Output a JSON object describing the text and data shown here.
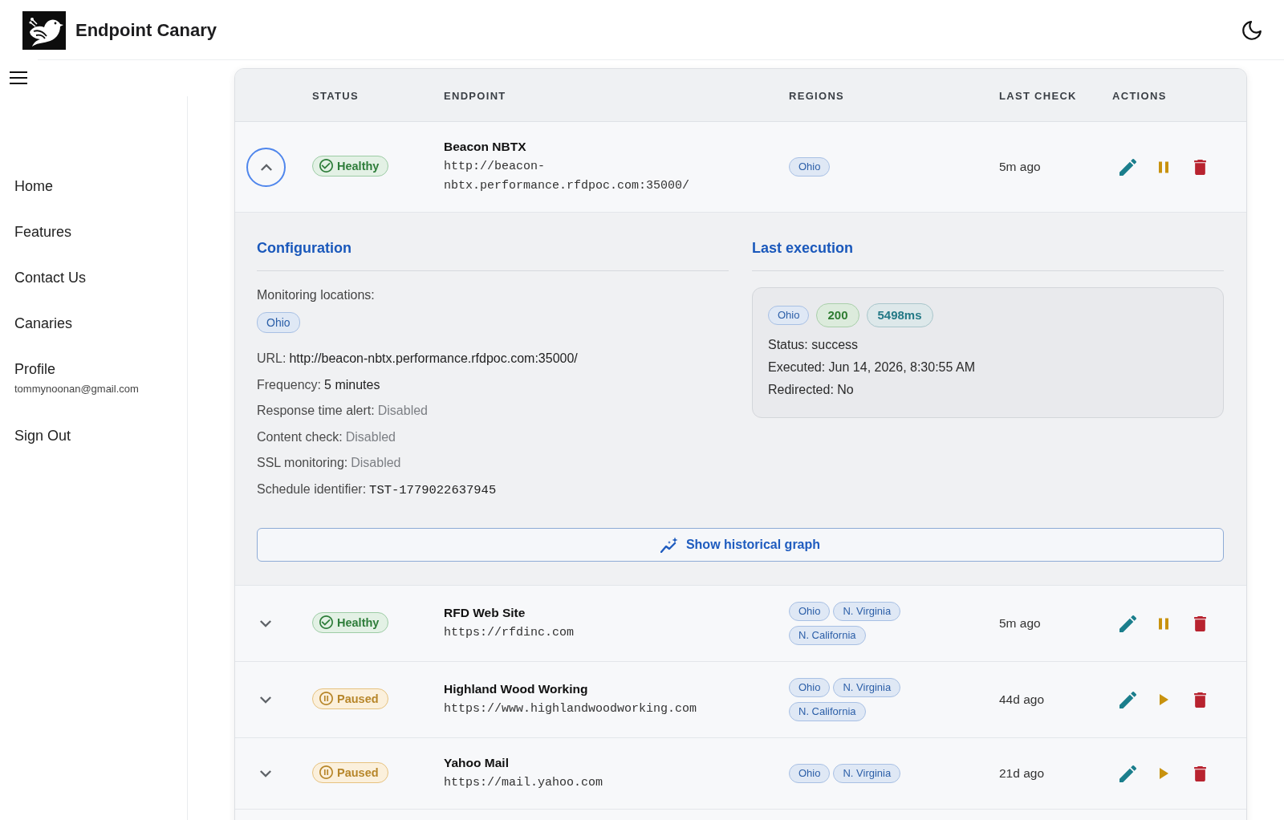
{
  "app": {
    "title": "Endpoint Canary"
  },
  "sidebar": {
    "items": [
      {
        "label": "Home"
      },
      {
        "label": "Features"
      },
      {
        "label": "Contact Us"
      },
      {
        "label": "Canaries"
      },
      {
        "label": "Profile",
        "detail": "tommynoonan@gmail.com"
      },
      {
        "label": "Sign Out"
      }
    ]
  },
  "table": {
    "columns": [
      "STATUS",
      "ENDPOINT",
      "REGIONS",
      "LAST CHECK",
      "ACTIONS"
    ],
    "rows": [
      {
        "expanded": true,
        "status": {
          "kind": "healthy",
          "label": "Healthy"
        },
        "name": "Beacon NBTX",
        "url": "http://beacon-nbtx.performance.rfdpoc.com:35000/",
        "regions": [
          "Ohio"
        ],
        "last_check": "5m ago",
        "details": {
          "configuration": {
            "title": "Configuration",
            "locations_label": "Monitoring locations:",
            "locations": [
              "Ohio"
            ],
            "fields": [
              {
                "label": "URL:",
                "value": "http://beacon-nbtx.performance.rfdpoc.com:35000/",
                "kind": "text"
              },
              {
                "label": "Frequency:",
                "value": "5 minutes",
                "kind": "text"
              },
              {
                "label": "Response time alert:",
                "value": "Disabled",
                "kind": "muted"
              },
              {
                "label": "Content check:",
                "value": "Disabled",
                "kind": "muted"
              },
              {
                "label": "SSL monitoring:",
                "value": "Disabled",
                "kind": "muted"
              },
              {
                "label": "Schedule identifier:",
                "value": "TST-1779022637945",
                "kind": "mono"
              }
            ]
          },
          "last_execution": {
            "title": "Last execution",
            "region": "Ohio",
            "status_code": "200",
            "duration": "5498ms",
            "lines": [
              "Status: success",
              "Executed: Jun 14, 2026, 8:30:55 AM",
              "Redirected: No"
            ]
          },
          "graph_button": "Show historical graph"
        }
      },
      {
        "expanded": false,
        "status": {
          "kind": "healthy",
          "label": "Healthy"
        },
        "name": "RFD Web Site",
        "url": "https://rfdinc.com",
        "regions": [
          "Ohio",
          "N. Virginia",
          "N. California"
        ],
        "last_check": "5m ago"
      },
      {
        "expanded": false,
        "status": {
          "kind": "paused",
          "label": "Paused"
        },
        "name": "Highland Wood Working",
        "url": "https://www.highlandwoodworking.com",
        "regions": [
          "Ohio",
          "N. Virginia",
          "N. California"
        ],
        "last_check": "44d ago"
      },
      {
        "expanded": false,
        "status": {
          "kind": "paused",
          "label": "Paused"
        },
        "name": "Yahoo Mail",
        "url": "https://mail.yahoo.com",
        "regions": [
          "Ohio",
          "N. Virginia"
        ],
        "last_check": "21d ago"
      }
    ]
  }
}
